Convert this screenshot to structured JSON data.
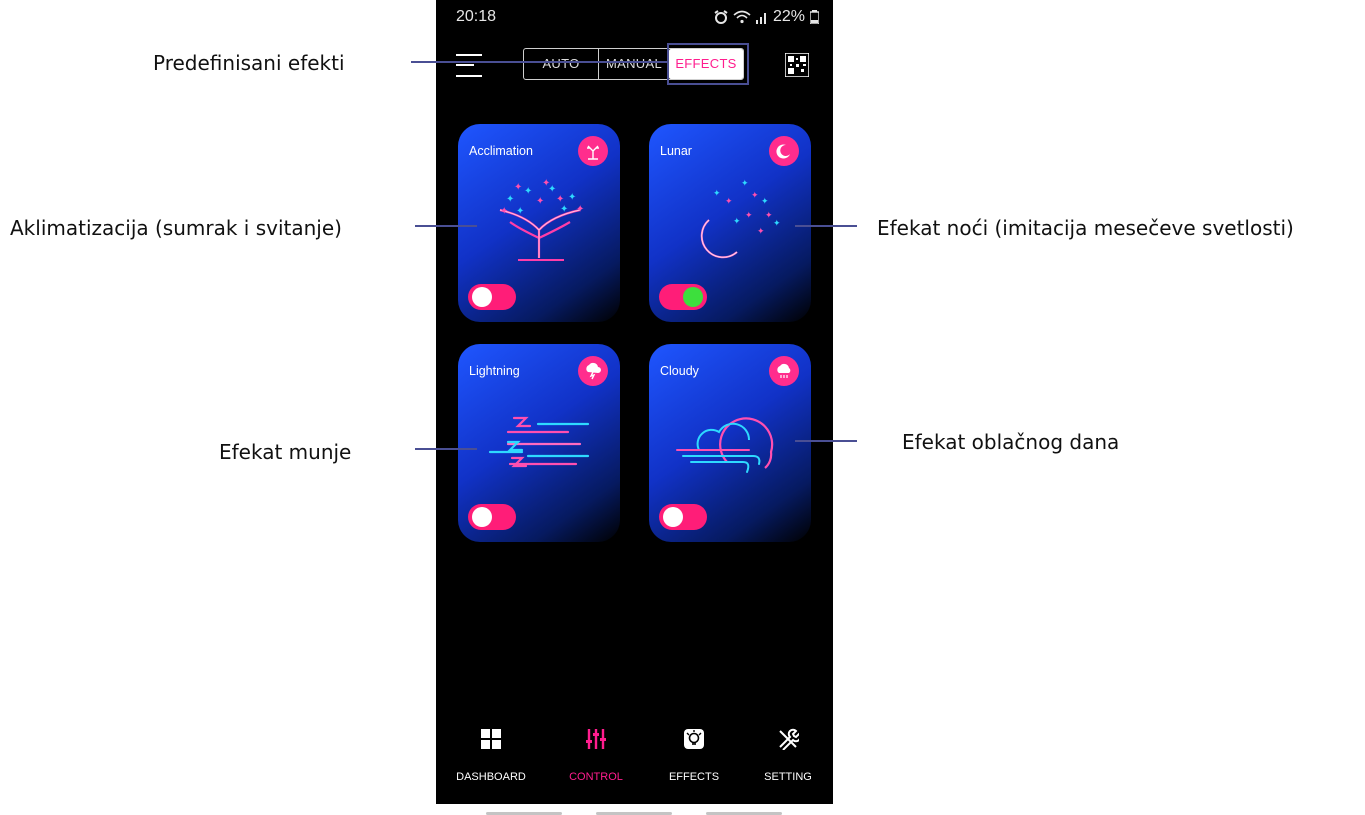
{
  "annotations": {
    "effects_tab": "Predefinisani efekti",
    "acclimation": "Aklimatizacija (sumrak i svitanje)",
    "lunar": "Efekat noći (imitacija mesečeve svetlosti)",
    "lightning": "Efekat munje",
    "cloudy": "Efekat oblačnog dana"
  },
  "status_bar": {
    "time": "20:18",
    "battery": "22%"
  },
  "mode_tabs": {
    "auto": "AUTO",
    "manual": "MANUAL",
    "effects": "EFFECTS",
    "selected": "EFFECTS"
  },
  "effects": [
    {
      "name": "Acclimation",
      "icon": "tree-icon",
      "enabled": false
    },
    {
      "name": "Lunar",
      "icon": "moon-icon",
      "enabled": true
    },
    {
      "name": "Lightning",
      "icon": "lightning-cloud-icon",
      "enabled": false
    },
    {
      "name": "Cloudy",
      "icon": "rain-cloud-icon",
      "enabled": false
    }
  ],
  "bottom_nav": {
    "dashboard": "DASHBOARD",
    "control": "CONTROL",
    "effects": "EFFECTS",
    "setting": "SETTING",
    "active": "CONTROL"
  },
  "colors": {
    "accent": "#ff1d8e",
    "card_blue": "#1f56ff",
    "toggle_on": "#3ddf3d",
    "annotation_line": "#4a4f94"
  }
}
